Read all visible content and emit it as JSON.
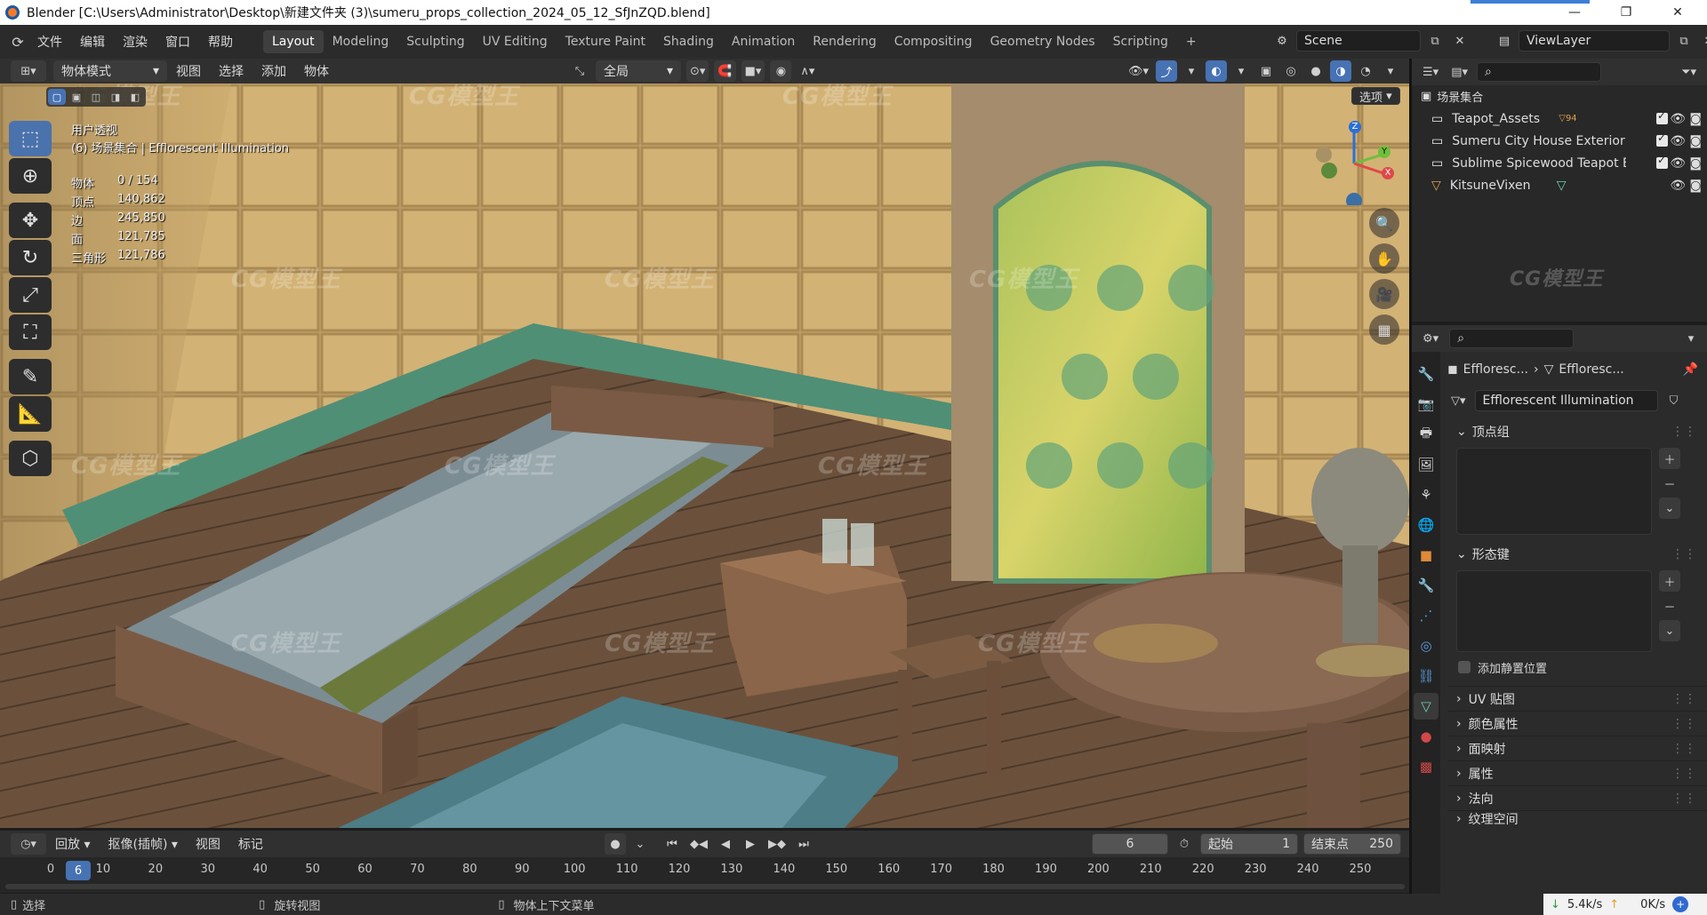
{
  "window": {
    "title": "Blender [C:\\Users\\Administrator\\Desktop\\新建文件夹 (3)\\sumeru_props_collection_2024_05_12_SfJnZQD.blend]",
    "min": "—",
    "max": "❐",
    "close": "✕"
  },
  "menu": {
    "items": [
      "文件",
      "编辑",
      "渲染",
      "窗口",
      "帮助"
    ],
    "workspaces": [
      "Layout",
      "Modeling",
      "Sculpting",
      "UV Editing",
      "Texture Paint",
      "Shading",
      "Animation",
      "Rendering",
      "Compositing",
      "Geometry Nodes",
      "Scripting"
    ],
    "active_workspace": "Layout",
    "add_tab": "+",
    "scene": "Scene",
    "view_layer": "ViewLayer"
  },
  "viewport_header": {
    "mode": "物体模式",
    "menus": [
      "视图",
      "选择",
      "添加",
      "物体"
    ],
    "orientation": "全局",
    "options": "选项"
  },
  "viewport": {
    "view_name": "用户透视",
    "collection_line": "(6) 场景集合 | Efflorescent Illumination",
    "stats": [
      {
        "label": "物体",
        "value": "0 / 154"
      },
      {
        "label": "顶点",
        "value": "140,862"
      },
      {
        "label": "边",
        "value": "245,850"
      },
      {
        "label": "面",
        "value": "121,785"
      },
      {
        "label": "三角形",
        "value": "121,786"
      }
    ],
    "gizmo": {
      "x": "X",
      "y": "Y",
      "z": "Z"
    },
    "watermark": "CG模型王"
  },
  "outliner": {
    "root": "场景集合",
    "items": [
      {
        "name": "Teapot_Assets",
        "badge": "94"
      },
      {
        "name": "Sumeru City House Exterior Inte",
        "badge": ""
      },
      {
        "name": "Sublime Spicewood Teapot Buil",
        "badge": ""
      },
      {
        "name": "KitsuneVixen",
        "badge": ""
      }
    ]
  },
  "properties": {
    "breadcrumb_obj": "Effloresc...",
    "breadcrumb_data": "Effloresc...",
    "data_name": "Efflorescent Illumination",
    "sections": {
      "vertex_groups": "顶点组",
      "shape_keys": "形态键",
      "add_rest_position": "添加静置位置",
      "uv_maps": "UV 贴图",
      "color_attributes": "颜色属性",
      "face_maps": "面映射",
      "attributes": "属性",
      "normals": "法向",
      "texture_space": "纹理空间"
    }
  },
  "timeline": {
    "playback": "回放",
    "keying": "抠像(插帧)",
    "view": "视图",
    "marker": "标记",
    "current_frame": "6",
    "start_label": "起始",
    "start": "1",
    "end_label": "结束点",
    "end": "250",
    "ticks": [
      "0",
      "10",
      "20",
      "30",
      "40",
      "50",
      "60",
      "70",
      "80",
      "90",
      "100",
      "110",
      "120",
      "130",
      "140",
      "150",
      "160",
      "170",
      "180",
      "190",
      "200",
      "210",
      "220",
      "230",
      "240",
      "250"
    ]
  },
  "status": {
    "select": "选择",
    "rotate_view": "旋转视图",
    "context_menu": "物体上下文菜单",
    "down_speed": "5.4k/s",
    "up_speed": "0K/s"
  }
}
